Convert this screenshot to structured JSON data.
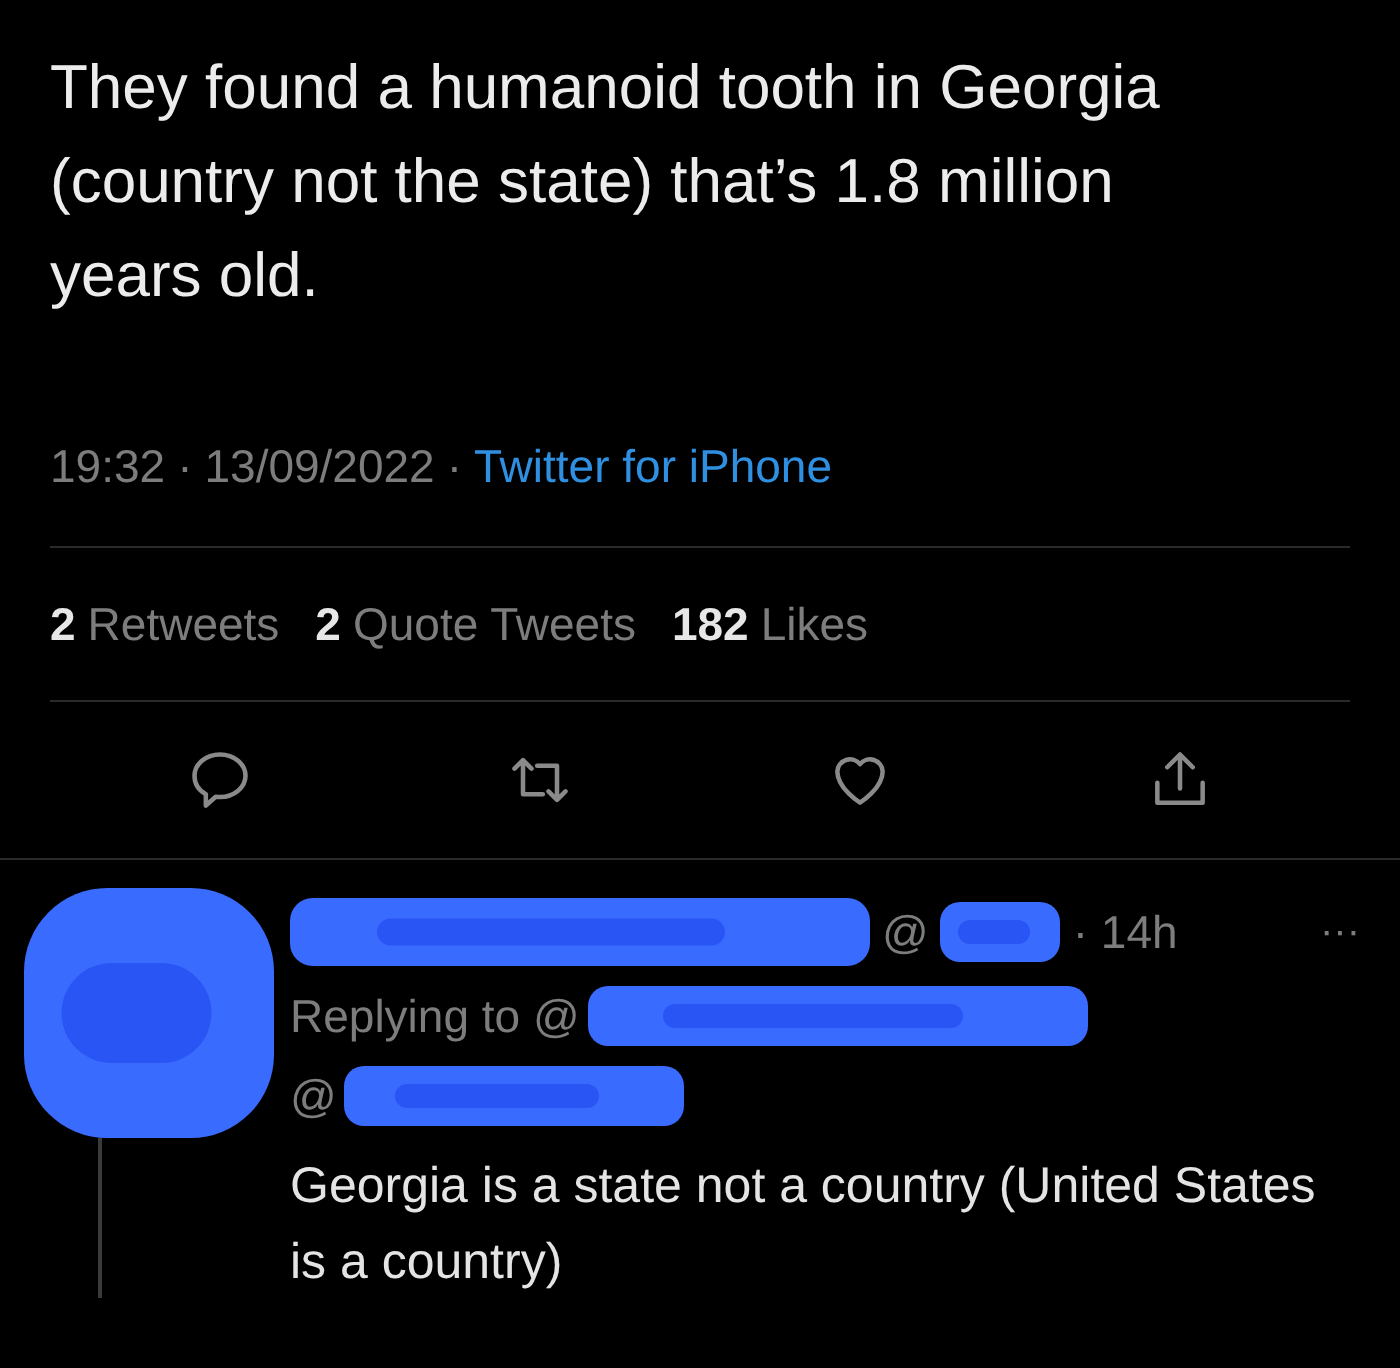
{
  "tweet": {
    "text": "They found a humanoid tooth in Georgia (country not the state) that’s 1.8 million years old.",
    "time": "19:32",
    "separator": "·",
    "date": "13/09/2022",
    "source": "Twitter for iPhone",
    "stats": [
      {
        "count": "2",
        "label": "Retweets"
      },
      {
        "count": "2",
        "label": "Quote Tweets"
      },
      {
        "count": "182",
        "label": "Likes"
      }
    ],
    "actions": [
      {
        "kind": "reply"
      },
      {
        "kind": "retweet"
      },
      {
        "kind": "like"
      },
      {
        "kind": "share"
      }
    ]
  },
  "reply": {
    "handle": "@",
    "time": "· 14h",
    "more": "···",
    "replying_to": "Replying to @",
    "mention": "@",
    "text": "Georgia is a state not a country (United States is a country)"
  }
}
